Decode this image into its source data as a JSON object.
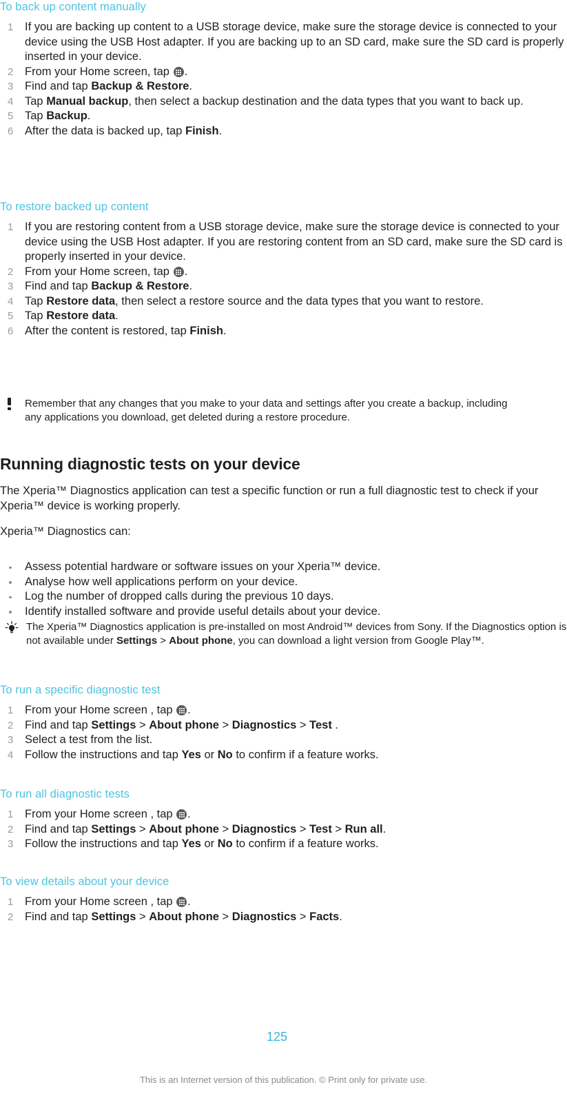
{
  "document": {
    "page_number": "125",
    "footer_note": "This is an Internet version of this publication. © Print only for private use.",
    "heading_color": "#4ec3e0",
    "page_number_color": "#36b6dd"
  },
  "sections": [
    {
      "id": "backup-manually",
      "heading": "To back up content manually",
      "steps": [
        {
          "parts": [
            {
              "t": "text",
              "v": "If you are backing up content to a USB storage device, make sure the storage device is connected to your device using the USB Host adapter. If you are backing up to an SD card, make sure the SD card is properly inserted in your device."
            }
          ]
        },
        {
          "parts": [
            {
              "t": "text",
              "v": "From your Home screen, tap "
            },
            {
              "t": "icon",
              "v": "app-drawer-icon"
            },
            {
              "t": "text",
              "v": "."
            }
          ]
        },
        {
          "parts": [
            {
              "t": "text",
              "v": "Find and tap "
            },
            {
              "t": "bold",
              "v": "Backup & Restore"
            },
            {
              "t": "text",
              "v": "."
            }
          ]
        },
        {
          "parts": [
            {
              "t": "text",
              "v": "Tap "
            },
            {
              "t": "bold",
              "v": "Manual backup"
            },
            {
              "t": "text",
              "v": ", then select a backup destination and the data types that you want to back up."
            }
          ]
        },
        {
          "parts": [
            {
              "t": "text",
              "v": "Tap "
            },
            {
              "t": "bold",
              "v": "Backup"
            },
            {
              "t": "text",
              "v": "."
            }
          ]
        },
        {
          "parts": [
            {
              "t": "text",
              "v": "After the data is backed up, tap "
            },
            {
              "t": "bold",
              "v": "Finish"
            },
            {
              "t": "text",
              "v": "."
            }
          ]
        }
      ]
    },
    {
      "id": "restore-backed-up",
      "heading": "To restore backed up content",
      "steps": [
        {
          "parts": [
            {
              "t": "text",
              "v": "If you are restoring content from a USB storage device, make sure the storage device is connected to your device using the USB Host adapter. If you are restoring content from an SD card, make sure the SD card is properly inserted in your device."
            }
          ]
        },
        {
          "parts": [
            {
              "t": "text",
              "v": "From your Home screen, tap "
            },
            {
              "t": "icon",
              "v": "app-drawer-icon"
            },
            {
              "t": "text",
              "v": "."
            }
          ]
        },
        {
          "parts": [
            {
              "t": "text",
              "v": "Find and tap "
            },
            {
              "t": "bold",
              "v": "Backup & Restore"
            },
            {
              "t": "text",
              "v": "."
            }
          ]
        },
        {
          "parts": [
            {
              "t": "text",
              "v": "Tap "
            },
            {
              "t": "bold",
              "v": "Restore data"
            },
            {
              "t": "text",
              "v": ", then select a restore source and the data types that you want to restore."
            }
          ]
        },
        {
          "parts": [
            {
              "t": "text",
              "v": "Tap "
            },
            {
              "t": "bold",
              "v": "Restore data"
            },
            {
              "t": "text",
              "v": "."
            }
          ]
        },
        {
          "parts": [
            {
              "t": "text",
              "v": "After the content is restored, tap "
            },
            {
              "t": "bold",
              "v": "Finish"
            },
            {
              "t": "text",
              "v": "."
            }
          ]
        }
      ]
    }
  ],
  "note_backup": {
    "icon": "exclamation-icon",
    "parts": [
      {
        "t": "text",
        "v": "Remember that any changes that you make to your data and settings after you create a backup, including any applications you download, get deleted during a restore procedure."
      }
    ]
  },
  "diagnostics": {
    "heading": "Running diagnostic tests on your device",
    "intro": "The Xperia™ Diagnostics application can test a specific function or run a full diagnostic test to check if your Xperia™ device is working properly.",
    "lead_in": "Xperia™ Diagnostics can:",
    "capabilities": [
      "Assess potential hardware or software issues on your Xperia™ device.",
      "Analyse how well applications perform on your device.",
      "Log the number of dropped calls during the previous 10 days.",
      "Identify installed software and provide useful details about your device."
    ],
    "tip": {
      "icon": "lightbulb-icon",
      "parts": [
        {
          "t": "text",
          "v": "The Xperia™ Diagnostics application is pre-installed on most Android™ devices from Sony. If the Diagnostics option is not available under "
        },
        {
          "t": "bold",
          "v": "Settings"
        },
        {
          "t": "text",
          "v": " > "
        },
        {
          "t": "bold",
          "v": "About phone"
        },
        {
          "t": "text",
          "v": ", you can download a light version from Google Play™."
        }
      ]
    },
    "procedures": [
      {
        "id": "run-specific-test",
        "heading": "To run a specific diagnostic test",
        "steps": [
          {
            "parts": [
              {
                "t": "text",
                "v": "From your Home screen , tap "
              },
              {
                "t": "icon",
                "v": "app-drawer-icon"
              },
              {
                "t": "text",
                "v": "."
              }
            ]
          },
          {
            "parts": [
              {
                "t": "text",
                "v": "Find and tap "
              },
              {
                "t": "bold",
                "v": "Settings"
              },
              {
                "t": "text",
                "v": " > "
              },
              {
                "t": "bold",
                "v": "About phone"
              },
              {
                "t": "text",
                "v": " > "
              },
              {
                "t": "bold",
                "v": "Diagnostics"
              },
              {
                "t": "text",
                "v": " > "
              },
              {
                "t": "bold",
                "v": "Test"
              },
              {
                "t": "text",
                "v": " ."
              }
            ]
          },
          {
            "parts": [
              {
                "t": "text",
                "v": "Select a test from the list."
              }
            ]
          },
          {
            "parts": [
              {
                "t": "text",
                "v": "Follow the instructions and tap "
              },
              {
                "t": "bold",
                "v": "Yes"
              },
              {
                "t": "text",
                "v": " or "
              },
              {
                "t": "bold",
                "v": "No"
              },
              {
                "t": "text",
                "v": " to confirm if a feature works."
              }
            ]
          }
        ]
      },
      {
        "id": "run-all-tests",
        "heading": "To run all diagnostic tests",
        "steps": [
          {
            "parts": [
              {
                "t": "text",
                "v": "From your Home screen , tap "
              },
              {
                "t": "icon",
                "v": "app-drawer-icon"
              },
              {
                "t": "text",
                "v": "."
              }
            ]
          },
          {
            "parts": [
              {
                "t": "text",
                "v": "Find and tap "
              },
              {
                "t": "bold",
                "v": "Settings"
              },
              {
                "t": "text",
                "v": " > "
              },
              {
                "t": "bold",
                "v": "About phone"
              },
              {
                "t": "text",
                "v": " > "
              },
              {
                "t": "bold",
                "v": "Diagnostics"
              },
              {
                "t": "text",
                "v": " > "
              },
              {
                "t": "bold",
                "v": "Test"
              },
              {
                "t": "text",
                "v": " > "
              },
              {
                "t": "bold",
                "v": "Run all"
              },
              {
                "t": "text",
                "v": "."
              }
            ]
          },
          {
            "parts": [
              {
                "t": "text",
                "v": "Follow the instructions and tap "
              },
              {
                "t": "bold",
                "v": "Yes"
              },
              {
                "t": "text",
                "v": " or "
              },
              {
                "t": "bold",
                "v": "No"
              },
              {
                "t": "text",
                "v": " to confirm if a feature works."
              }
            ]
          }
        ]
      },
      {
        "id": "view-device-details",
        "heading": "To view details about your device",
        "steps": [
          {
            "parts": [
              {
                "t": "text",
                "v": "From your Home screen , tap "
              },
              {
                "t": "icon",
                "v": "app-drawer-icon"
              },
              {
                "t": "text",
                "v": "."
              }
            ]
          },
          {
            "parts": [
              {
                "t": "text",
                "v": "Find and tap "
              },
              {
                "t": "bold",
                "v": "Settings"
              },
              {
                "t": "text",
                "v": " > "
              },
              {
                "t": "bold",
                "v": "About phone"
              },
              {
                "t": "text",
                "v": " > "
              },
              {
                "t": "bold",
                "v": "Diagnostics"
              },
              {
                "t": "text",
                "v": " > "
              },
              {
                "t": "bold",
                "v": "Facts"
              },
              {
                "t": "text",
                "v": "."
              }
            ]
          }
        ]
      }
    ]
  }
}
